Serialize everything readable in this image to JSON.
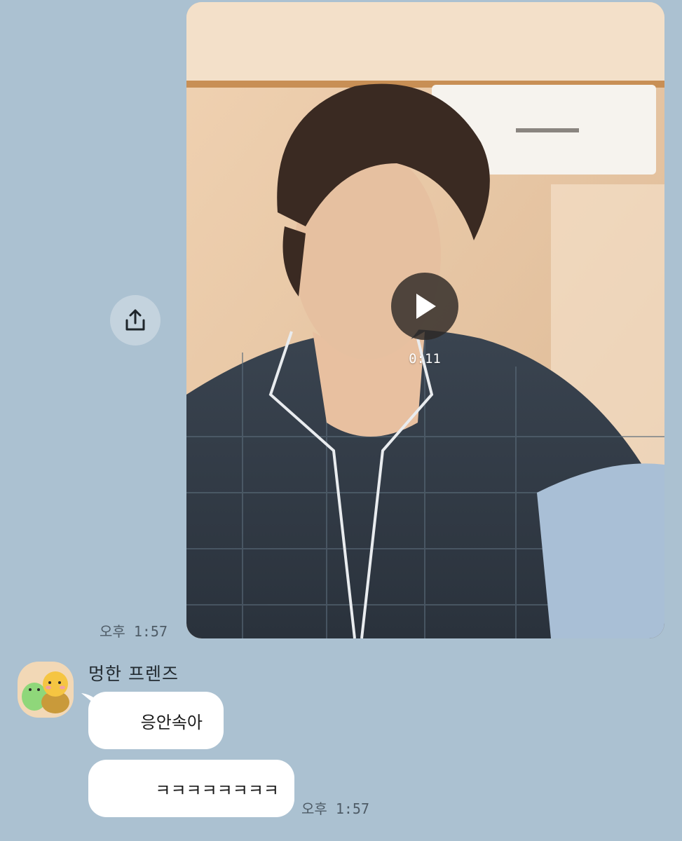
{
  "video_message": {
    "duration": "0:11",
    "timestamp": "오후 1:57"
  },
  "share": {
    "icon": "share-icon"
  },
  "incoming": {
    "sender_name": "멍한 프렌즈",
    "avatar_icon": "character-avatar-icon",
    "messages": [
      {
        "text": "응안속아"
      },
      {
        "text": "ㅋㅋㅋㅋㅋㅋㅋㅋ"
      }
    ],
    "timestamp": "오후 1:57"
  },
  "colors": {
    "chat_background": "#abc1d1",
    "bubble": "#ffffff",
    "play_overlay": "#2d2826"
  }
}
